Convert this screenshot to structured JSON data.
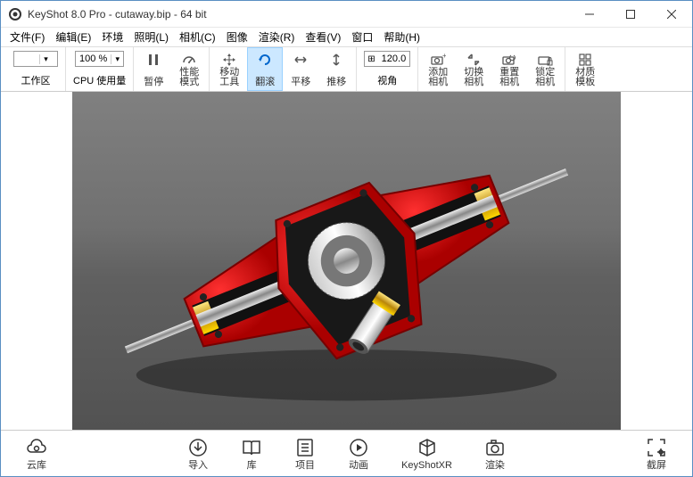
{
  "title": "KeyShot 8.0 Pro  - cutaway.bip  - 64 bit",
  "menu": {
    "file": "文件(F)",
    "edit": "编辑(E)",
    "env": "环境",
    "light": "照明(L)",
    "camera": "相机(C)",
    "image": "图像",
    "render": "渲染(R)",
    "view": "查看(V)",
    "window": "窗口",
    "help": "帮助(H)"
  },
  "toolbar": {
    "workspace_combo": "",
    "workspace": "工作区",
    "cpu_val": "100 %",
    "cpu": "CPU 使用量",
    "pause": "暂停",
    "perf": "性能\n模式",
    "move": "移动\n工具",
    "tumble": "翻滚",
    "pan": "平移",
    "dolly": "推移",
    "angle_val": "120.0",
    "angle": "视角",
    "add_cam": "添加\n相机",
    "switch_cam": "切换\n相机",
    "reset_cam": "重置\n相机",
    "lock_cam": "锁定\n相机",
    "mat_tpl": "材质\n模板"
  },
  "bottom": {
    "cloud": "云库",
    "import": "导入",
    "library": "库",
    "project": "项目",
    "anim": "动画",
    "xr": "KeyShotXR",
    "render": "渲染",
    "screenshot": "截屏"
  }
}
